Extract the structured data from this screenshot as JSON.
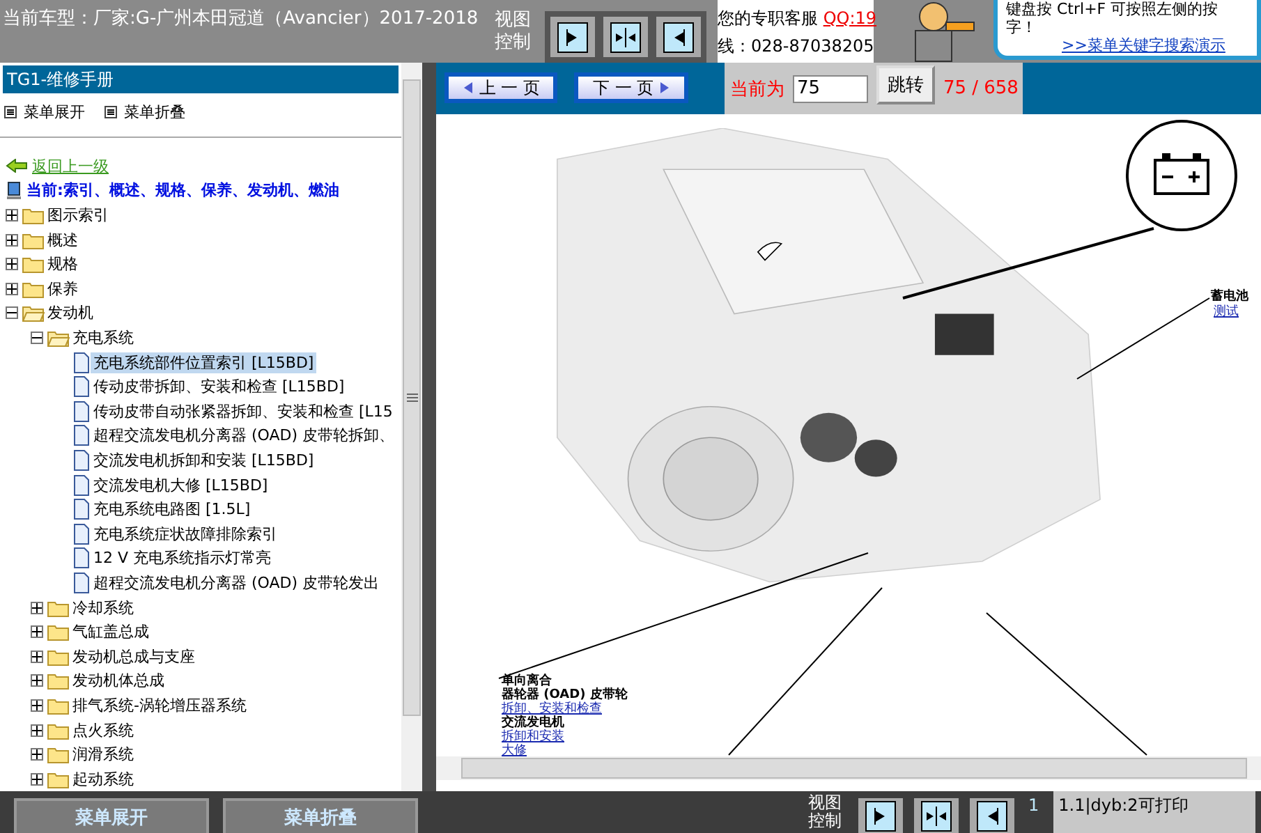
{
  "header": {
    "vehicle": "当前车型：厂家:G-广州本田冠道（Avancier）2017-2018",
    "view_label": "视图控制",
    "support_label": "您的专职客服",
    "support_qq": "QQ:19",
    "support_phone": "线：028-87038205",
    "tip_line1": "键盘按 Ctrl+F 可按照左侧的按",
    "tip_line2": "字！",
    "tip_link": ">>菜单关键字搜索演示"
  },
  "sidebar": {
    "title": "TG1-维修手册",
    "expand_label": "菜单展开",
    "collapse_label": "菜单折叠",
    "back_link": "返回上一级",
    "current_path": "当前:索引、概述、规格、保养、发动机、燃油",
    "tree": [
      {
        "label": "图示索引",
        "kind": "folder",
        "expanded": false
      },
      {
        "label": "概述",
        "kind": "folder",
        "expanded": false
      },
      {
        "label": "规格",
        "kind": "folder",
        "expanded": false
      },
      {
        "label": "保养",
        "kind": "folder",
        "expanded": false
      },
      {
        "label": "发动机",
        "kind": "folder",
        "expanded": true,
        "children": [
          {
            "label": "充电系统",
            "kind": "folder",
            "expanded": true,
            "children": [
              {
                "label": "充电系统部件位置索引 [L15BD]",
                "kind": "page",
                "selected": true
              },
              {
                "label": "传动皮带拆卸、安装和检查 [L15BD]",
                "kind": "page",
                "selected": false
              },
              {
                "label": "传动皮带自动张紧器拆卸、安装和检查 [L15",
                "kind": "page",
                "selected": false
              },
              {
                "label": "超程交流发电机分离器 (OAD) 皮带轮拆卸、",
                "kind": "page",
                "selected": false
              },
              {
                "label": "交流发电机拆卸和安装 [L15BD]",
                "kind": "page",
                "selected": false
              },
              {
                "label": "交流发电机大修 [L15BD]",
                "kind": "page",
                "selected": false
              },
              {
                "label": "充电系统电路图 [1.5L]",
                "kind": "page",
                "selected": false
              },
              {
                "label": "充电系统症状故障排除索引",
                "kind": "page",
                "selected": false
              },
              {
                "label": "12 V 充电系统指示灯常亮",
                "kind": "page",
                "selected": false
              },
              {
                "label": "超程交流发电机分离器 (OAD) 皮带轮发出",
                "kind": "page",
                "selected": false
              }
            ]
          },
          {
            "label": "冷却系统",
            "kind": "folder",
            "expanded": false
          },
          {
            "label": "气缸盖总成",
            "kind": "folder",
            "expanded": false
          },
          {
            "label": "发动机总成与支座",
            "kind": "folder",
            "expanded": false
          },
          {
            "label": "发动机体总成",
            "kind": "folder",
            "expanded": false
          },
          {
            "label": "排气系统-涡轮增压器系统",
            "kind": "folder",
            "expanded": false
          },
          {
            "label": "点火系统",
            "kind": "folder",
            "expanded": false
          },
          {
            "label": "润滑系统",
            "kind": "folder",
            "expanded": false
          },
          {
            "label": "起动系统",
            "kind": "folder",
            "expanded": false
          }
        ]
      }
    ]
  },
  "pager": {
    "prev": "上 一 页",
    "next": "下 一 页",
    "current_label": "当前为",
    "page_value": "75",
    "go": "跳转",
    "page_count": "75 / 658"
  },
  "figure": {
    "battery_label": "蓄电池",
    "battery_link": "测试",
    "oad_label1": "单向离合",
    "oad_label2": "器轮器 (OAD) 皮带轮",
    "oad_link": "拆卸、安装和检查",
    "alt_label": "交流发电机",
    "alt_link1": "拆卸和安装",
    "alt_link2": "大修"
  },
  "footer": {
    "expand_button": "菜单展开",
    "collapse_button": "菜单折叠",
    "view_label": "视图控制",
    "page_number": "1",
    "print_status": "1.1|dyb:2可打印"
  }
}
